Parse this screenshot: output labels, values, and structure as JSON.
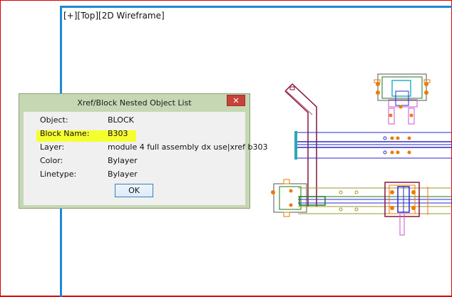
{
  "viewport": {
    "label": "[+][Top][2D Wireframe]"
  },
  "dialog": {
    "title": "Xref/Block Nested Object List",
    "close_glyph": "✕",
    "rows": [
      {
        "key": "Object:",
        "value": "BLOCK"
      },
      {
        "key": "Block Name:",
        "value": "B303"
      },
      {
        "key": "Layer:",
        "value": "module 4 full assembly dx use|xref b303"
      },
      {
        "key": "Color:",
        "value": "Bylayer"
      },
      {
        "key": "Linetype:",
        "value": "Bylayer"
      }
    ],
    "ok_label": "OK"
  },
  "colors": {
    "highlight": "#f6ff2e",
    "viewport_border": "#1e88d8",
    "dialog_frame": "#c6d7b4",
    "close_button": "#c7423a"
  }
}
